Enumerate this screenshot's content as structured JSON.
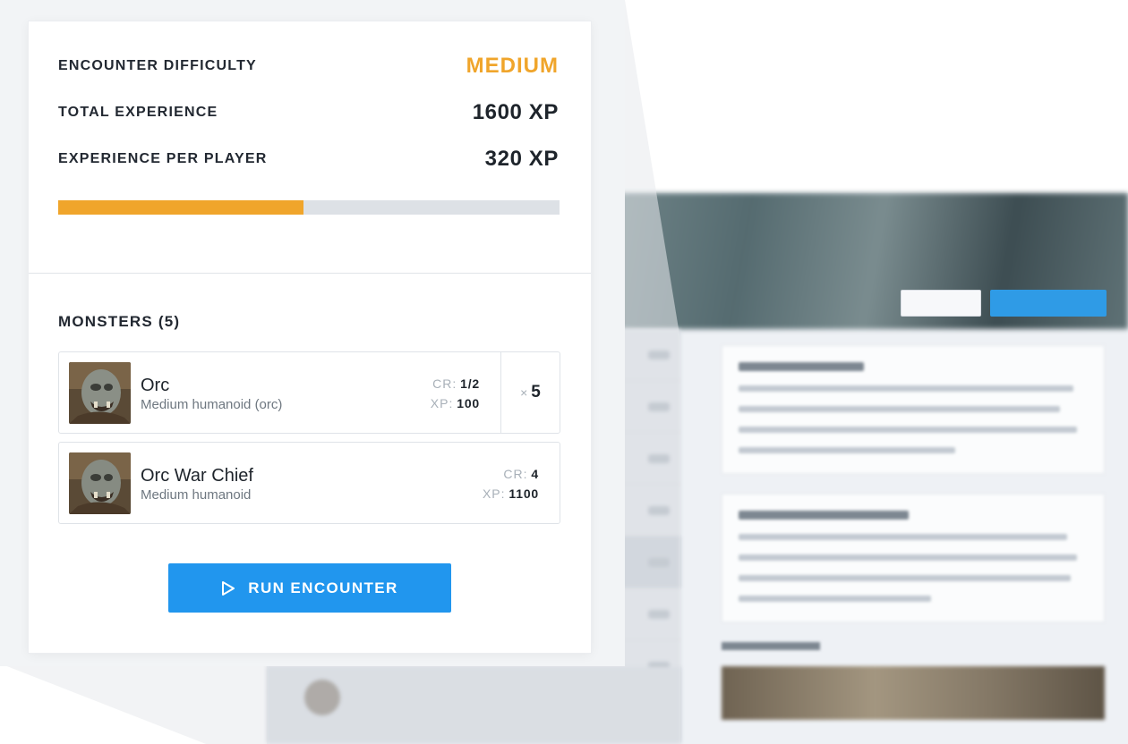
{
  "summary": {
    "difficulty_label": "ENCOUNTER DIFFICULTY",
    "difficulty_value": "MEDIUM",
    "total_label": "TOTAL EXPERIENCE",
    "total_value": "1600 XP",
    "per_player_label": "EXPERIENCE PER PLAYER",
    "per_player_value": "320 XP",
    "difficulty_progress": 0.49,
    "accent_color": "#f0a52b"
  },
  "monsters": {
    "title": "MONSTERS (5)",
    "items": [
      {
        "name": "Orc",
        "type": "Medium humanoid (orc)",
        "cr_label": "CR:",
        "cr": "1/2",
        "xp_label": "XP:",
        "xp": "100",
        "qty_symbol": "×",
        "qty": "5",
        "portrait": "orc-portrait"
      },
      {
        "name": "Orc War Chief",
        "type": "Medium humanoid",
        "cr_label": "CR:",
        "cr": "4",
        "xp_label": "XP:",
        "xp": "1100",
        "portrait": "orc-war-chief-portrait"
      }
    ]
  },
  "actions": {
    "run_label": "RUN ENCOUNTER",
    "run_icon": "play-icon",
    "button_color": "#2196ee"
  }
}
